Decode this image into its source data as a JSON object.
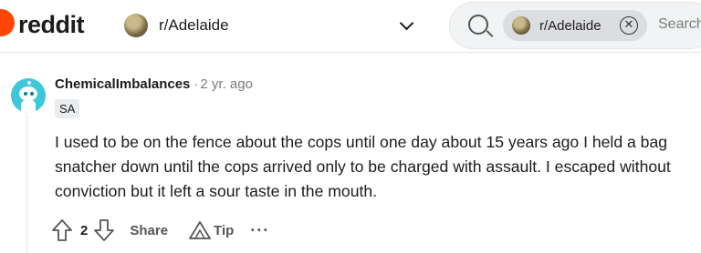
{
  "header": {
    "wordmark": "reddit",
    "subreddit": "r/Adelaide",
    "search_chip": "r/Adelaide",
    "search_placeholder": "Search",
    "chip_close_glyph": "✕"
  },
  "comment": {
    "author": "ChemicalImbalances",
    "separator": "·",
    "time": "2 yr. ago",
    "flair": "SA",
    "body": "I used to be on the fence about the cops until one day about 15 years ago I held a bag snatcher down until the cops arrived only to be charged with assault. I escaped without conviction but it left a sour taste in the mouth.",
    "score": "2",
    "share_label": "Share",
    "tip_label": "Tip",
    "more_label": "···"
  },
  "colors": {
    "brand": "#ff4500",
    "avatar": "#3ec6d9",
    "text": "#1c1c1c",
    "muted": "#7c7c7c"
  }
}
